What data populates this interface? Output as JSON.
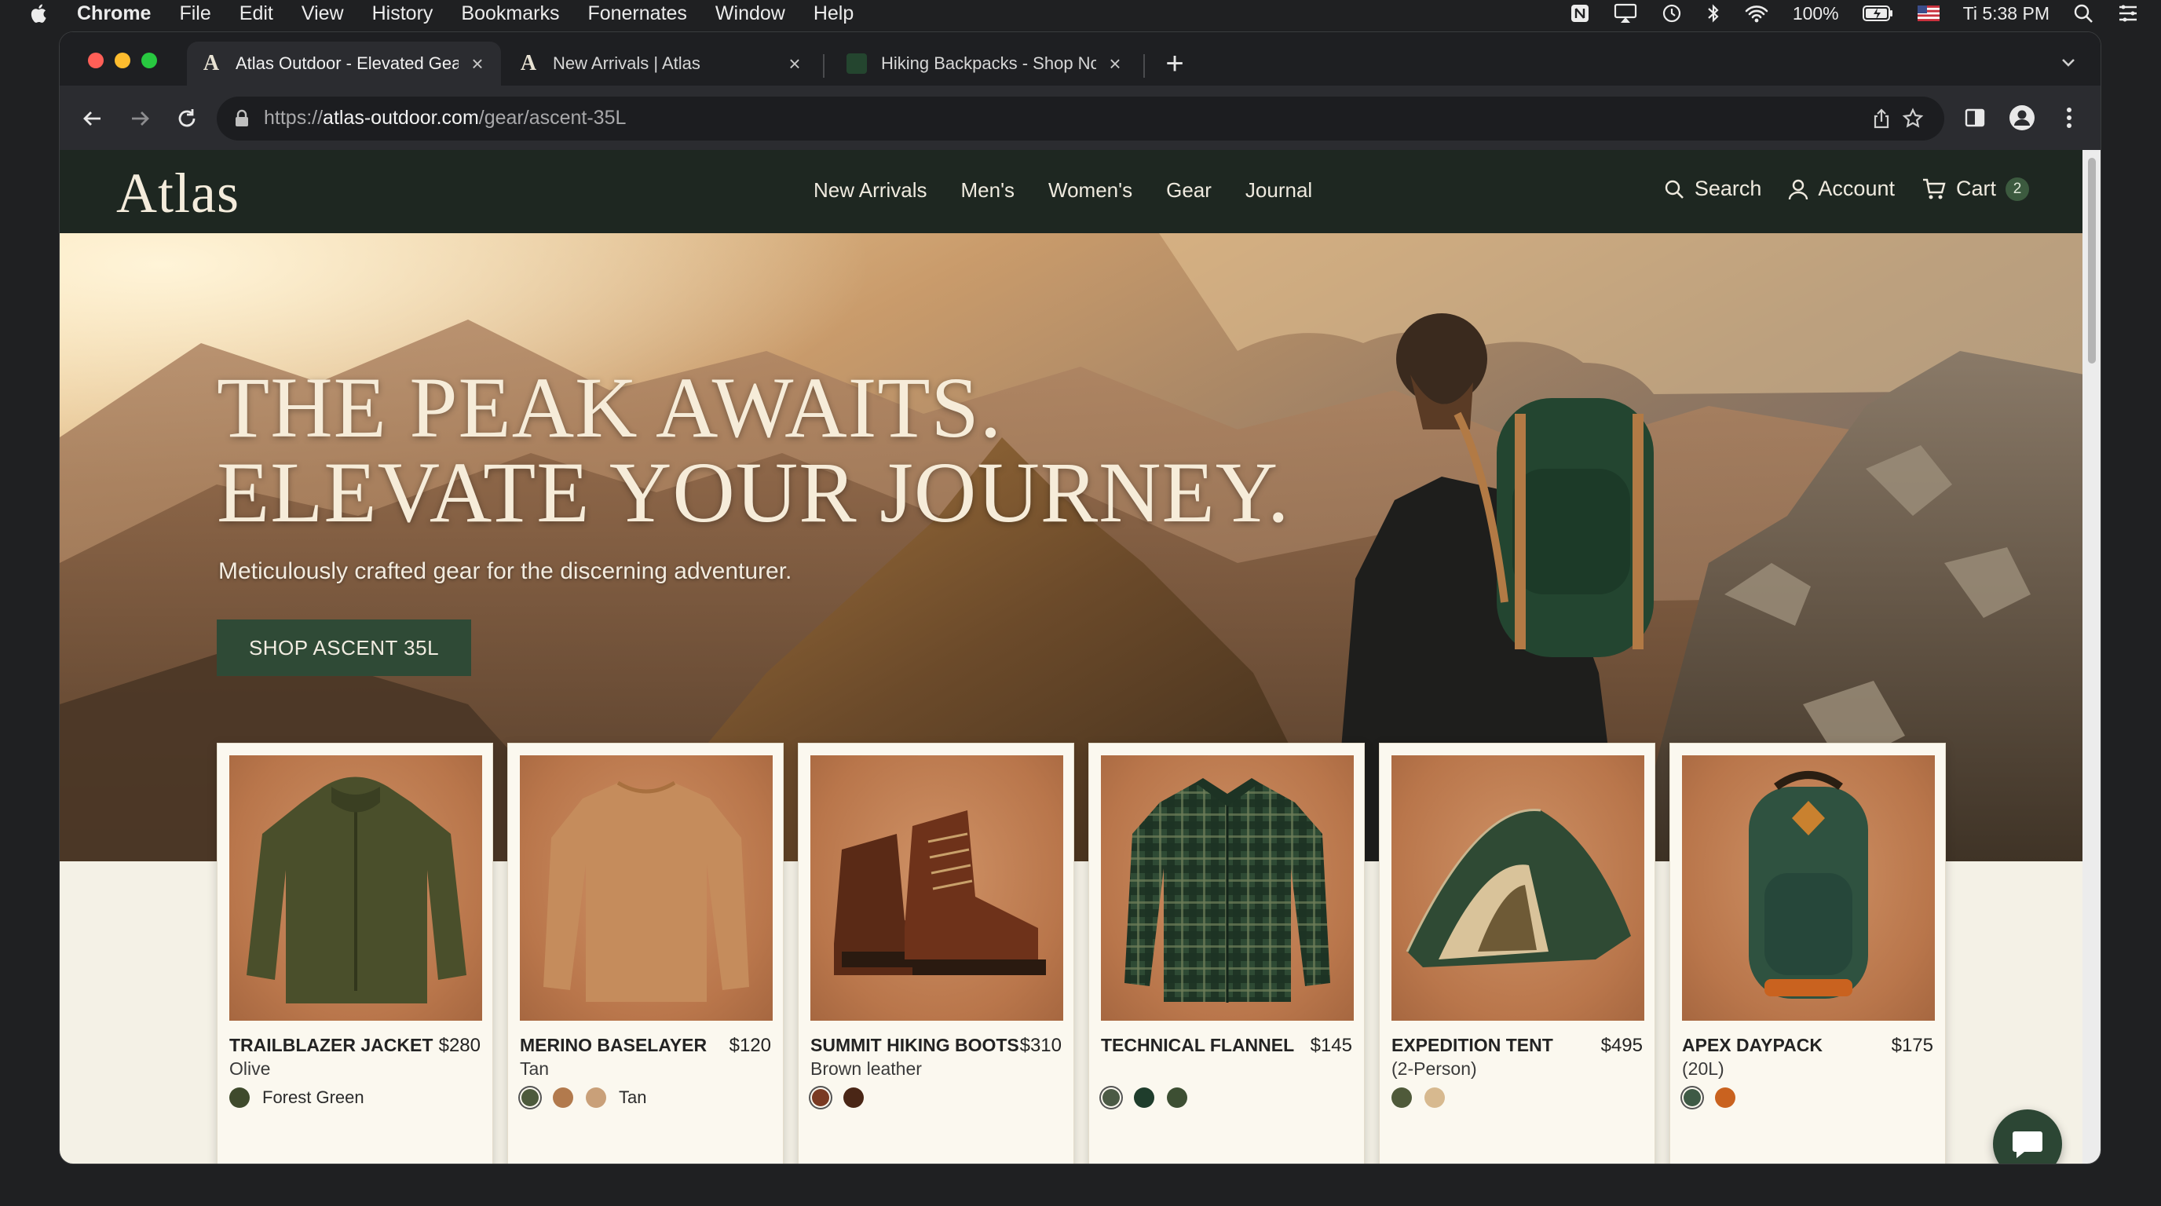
{
  "menubar": {
    "app": "Chrome",
    "menus": [
      "File",
      "Edit",
      "View",
      "History",
      "Bookmarks",
      "Fonernates",
      "Window",
      "Help"
    ],
    "battery": "100%",
    "clock": "Ti 5:38 PM"
  },
  "browser": {
    "tabs": [
      {
        "title": "Atlas Outdoor - Elevated Gear",
        "favicon": "A"
      },
      {
        "title": "New Arrivals | Atlas",
        "favicon": "A"
      },
      {
        "title": "Hiking Backpacks - Shop Now",
        "favicon": ""
      }
    ],
    "url_scheme": "https://",
    "url_host": "atlas-outdoor.com",
    "url_path": "/gear/ascent-35L"
  },
  "site": {
    "logo": "Atlas",
    "nav": [
      "New Arrivals",
      "Men's",
      "Women's",
      "Gear",
      "Journal"
    ],
    "search": "Search",
    "account": "Account",
    "cart": "Cart",
    "cart_count": "2"
  },
  "hero": {
    "line1": "THE PEAK AWAITS.",
    "line2": "ELEVATE YOUR JOURNEY.",
    "subtitle": "Meticulously crafted gear for the discerning adventurer.",
    "cta": "SHOP ASCENT 35L"
  },
  "products": [
    {
      "name": "TRAILBLAZER JACKET",
      "price": "$280",
      "variant": "Olive",
      "swatches": [
        "#3f4a2c"
      ],
      "swatch_label": "Forest Green"
    },
    {
      "name": "MERINO BASELAYER",
      "price": "$120",
      "variant": "Tan",
      "swatches": [
        "#4d5a3c",
        "#b27a4d",
        "#c9a079"
      ],
      "swatch_label": "Tan"
    },
    {
      "name": "SUMMIT HIKING BOOTS",
      "price": "$310",
      "variant": "Brown leather",
      "swatches": [
        "#7a3a22",
        "#4a2616"
      ],
      "swatch_label": ""
    },
    {
      "name": "TECHNICAL FLANNEL",
      "price": "$145",
      "variant": "",
      "swatches": [
        "#4b5a45",
        "#1f3d2c",
        "#3d4f33"
      ],
      "swatch_label": ""
    },
    {
      "name": "EXPEDITION TENT",
      "price": "$495",
      "variant": "(2-Person)",
      "swatches": [
        "#4f5a3a",
        "#d7b98f"
      ],
      "swatch_label": ""
    },
    {
      "name": "APEX DAYPACK",
      "price": "$175",
      "variant": "(20L)",
      "swatches": [
        "#3e5a45",
        "#c9621f"
      ],
      "swatch_label": ""
    }
  ],
  "icons": {
    "apple": "apple-icon",
    "back": "arrow-left-icon",
    "forward": "arrow-right-icon",
    "reload": "reload-icon",
    "lock": "lock-icon",
    "share": "share-icon",
    "bookmark": "star-icon",
    "sidepanel": "side-panel-icon",
    "profile": "profile-icon",
    "menu": "kebab-menu-icon",
    "search": "search-icon",
    "account": "user-icon",
    "cart": "cart-icon",
    "chat": "chat-bubble-icon"
  },
  "colors": {
    "nav_bg": "#1e2721",
    "cta_bg": "#2f4a36",
    "cream": "#f4f1e6",
    "hero_text": "#f6ecd9"
  }
}
